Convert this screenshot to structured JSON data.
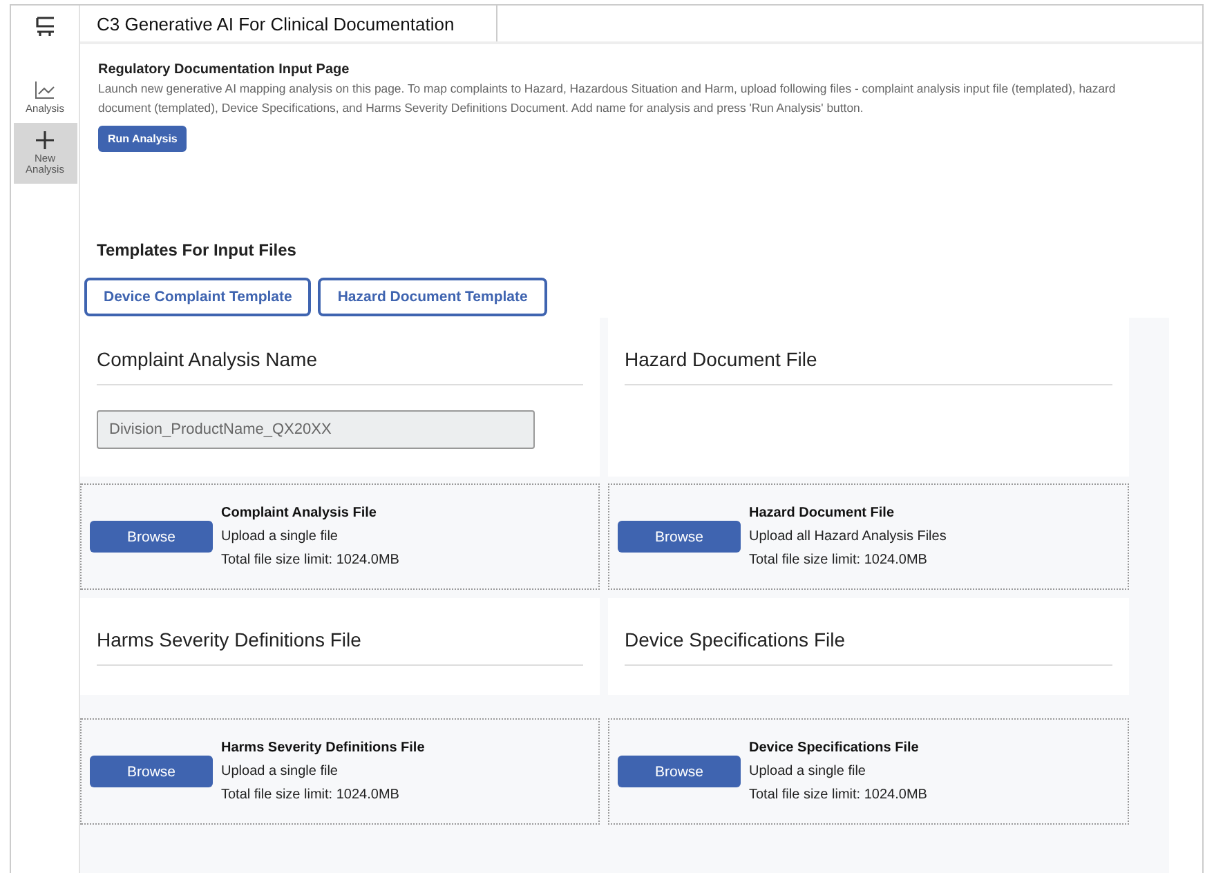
{
  "sidebar": {
    "items": [
      {
        "label": "Analysis",
        "kind": "chart",
        "selected": false
      },
      {
        "label": "New Analysis",
        "kind": "plus",
        "selected": true
      }
    ]
  },
  "header": {
    "title": "C3 Generative AI For Clinical Documentation"
  },
  "intro": {
    "title": "Regulatory Documentation Input Page",
    "description": "Launch new generative AI mapping analysis on this page. To map complaints to Hazard, Hazardous Situation and Harm, upload following files - complaint analysis input file (templated), hazard document (templated), Device Specifications, and Harms Severity Definitions Document. Add name for analysis and press 'Run Analysis' button.",
    "button": "Run Analysis"
  },
  "templates": {
    "title": "Templates For Input Files",
    "buttons": [
      "Device Complaint Template",
      "Hazard Document Template"
    ]
  },
  "sections": [
    {
      "heading": "Complaint Analysis Name",
      "field": {
        "placeholder": "Division_ProductName_QX20XX"
      }
    },
    {
      "heading": "Hazard Document File"
    },
    {
      "upload": {
        "button": "Browse",
        "title": "Complaint Analysis File",
        "hint": "Upload a single file",
        "limit": "Total file size limit: 1024.0MB"
      }
    },
    {
      "upload": {
        "button": "Browse",
        "title": "Hazard Document File",
        "hint": "Upload all Hazard Analysis Files",
        "limit": "Total file size limit: 1024.0MB"
      }
    },
    {
      "heading": "Harms Severity Definitions File"
    },
    {
      "heading": "Device Specifications File"
    },
    {
      "upload": {
        "button": "Browse",
        "title": "Harms Severity Definitions File",
        "hint": "Upload a single file",
        "limit": "Total file size limit: 1024.0MB"
      }
    },
    {
      "upload": {
        "button": "Browse",
        "title": "Device Specifications File",
        "hint": "Upload a single file",
        "limit": "Total file size limit: 1024.0MB"
      }
    }
  ]
}
